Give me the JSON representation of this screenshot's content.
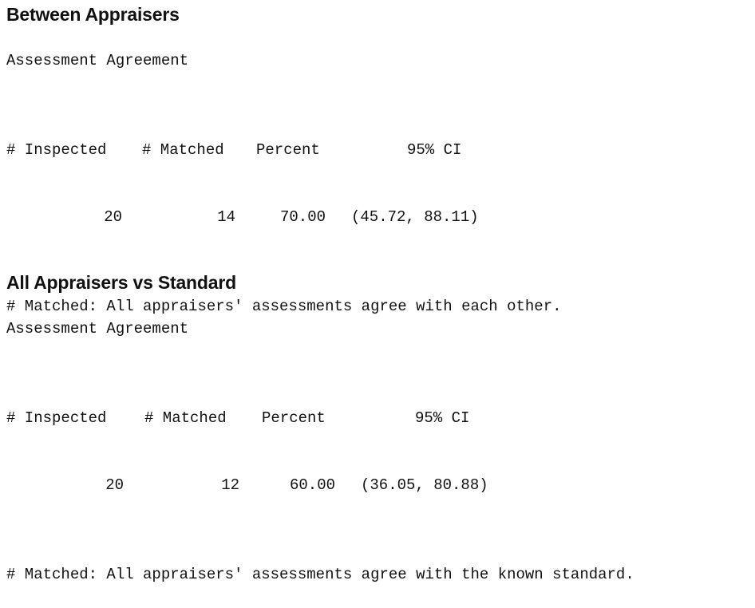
{
  "between": {
    "title": "Between Appraisers",
    "subtitle": "Assessment Agreement",
    "headers": {
      "inspected": "# Inspected",
      "matched": "# Matched",
      "percent": "Percent",
      "ci": "95% CI"
    },
    "row": {
      "inspected": "20",
      "matched": "14",
      "percent": "70.00",
      "ci": "(45.72, 88.11)"
    },
    "footnote": "# Matched: All appraisers' assessments agree with each other."
  },
  "standard": {
    "title": "All Appraisers vs Standard",
    "subtitle": "Assessment Agreement",
    "headers": {
      "inspected": "# Inspected",
      "matched": "# Matched",
      "percent": "Percent",
      "ci": "95% CI"
    },
    "row": {
      "inspected": "20",
      "matched": "12",
      "percent": "60.00",
      "ci": "(36.05, 80.88)"
    },
    "footnote": "# Matched: All appraisers' assessments agree with the known standard."
  }
}
